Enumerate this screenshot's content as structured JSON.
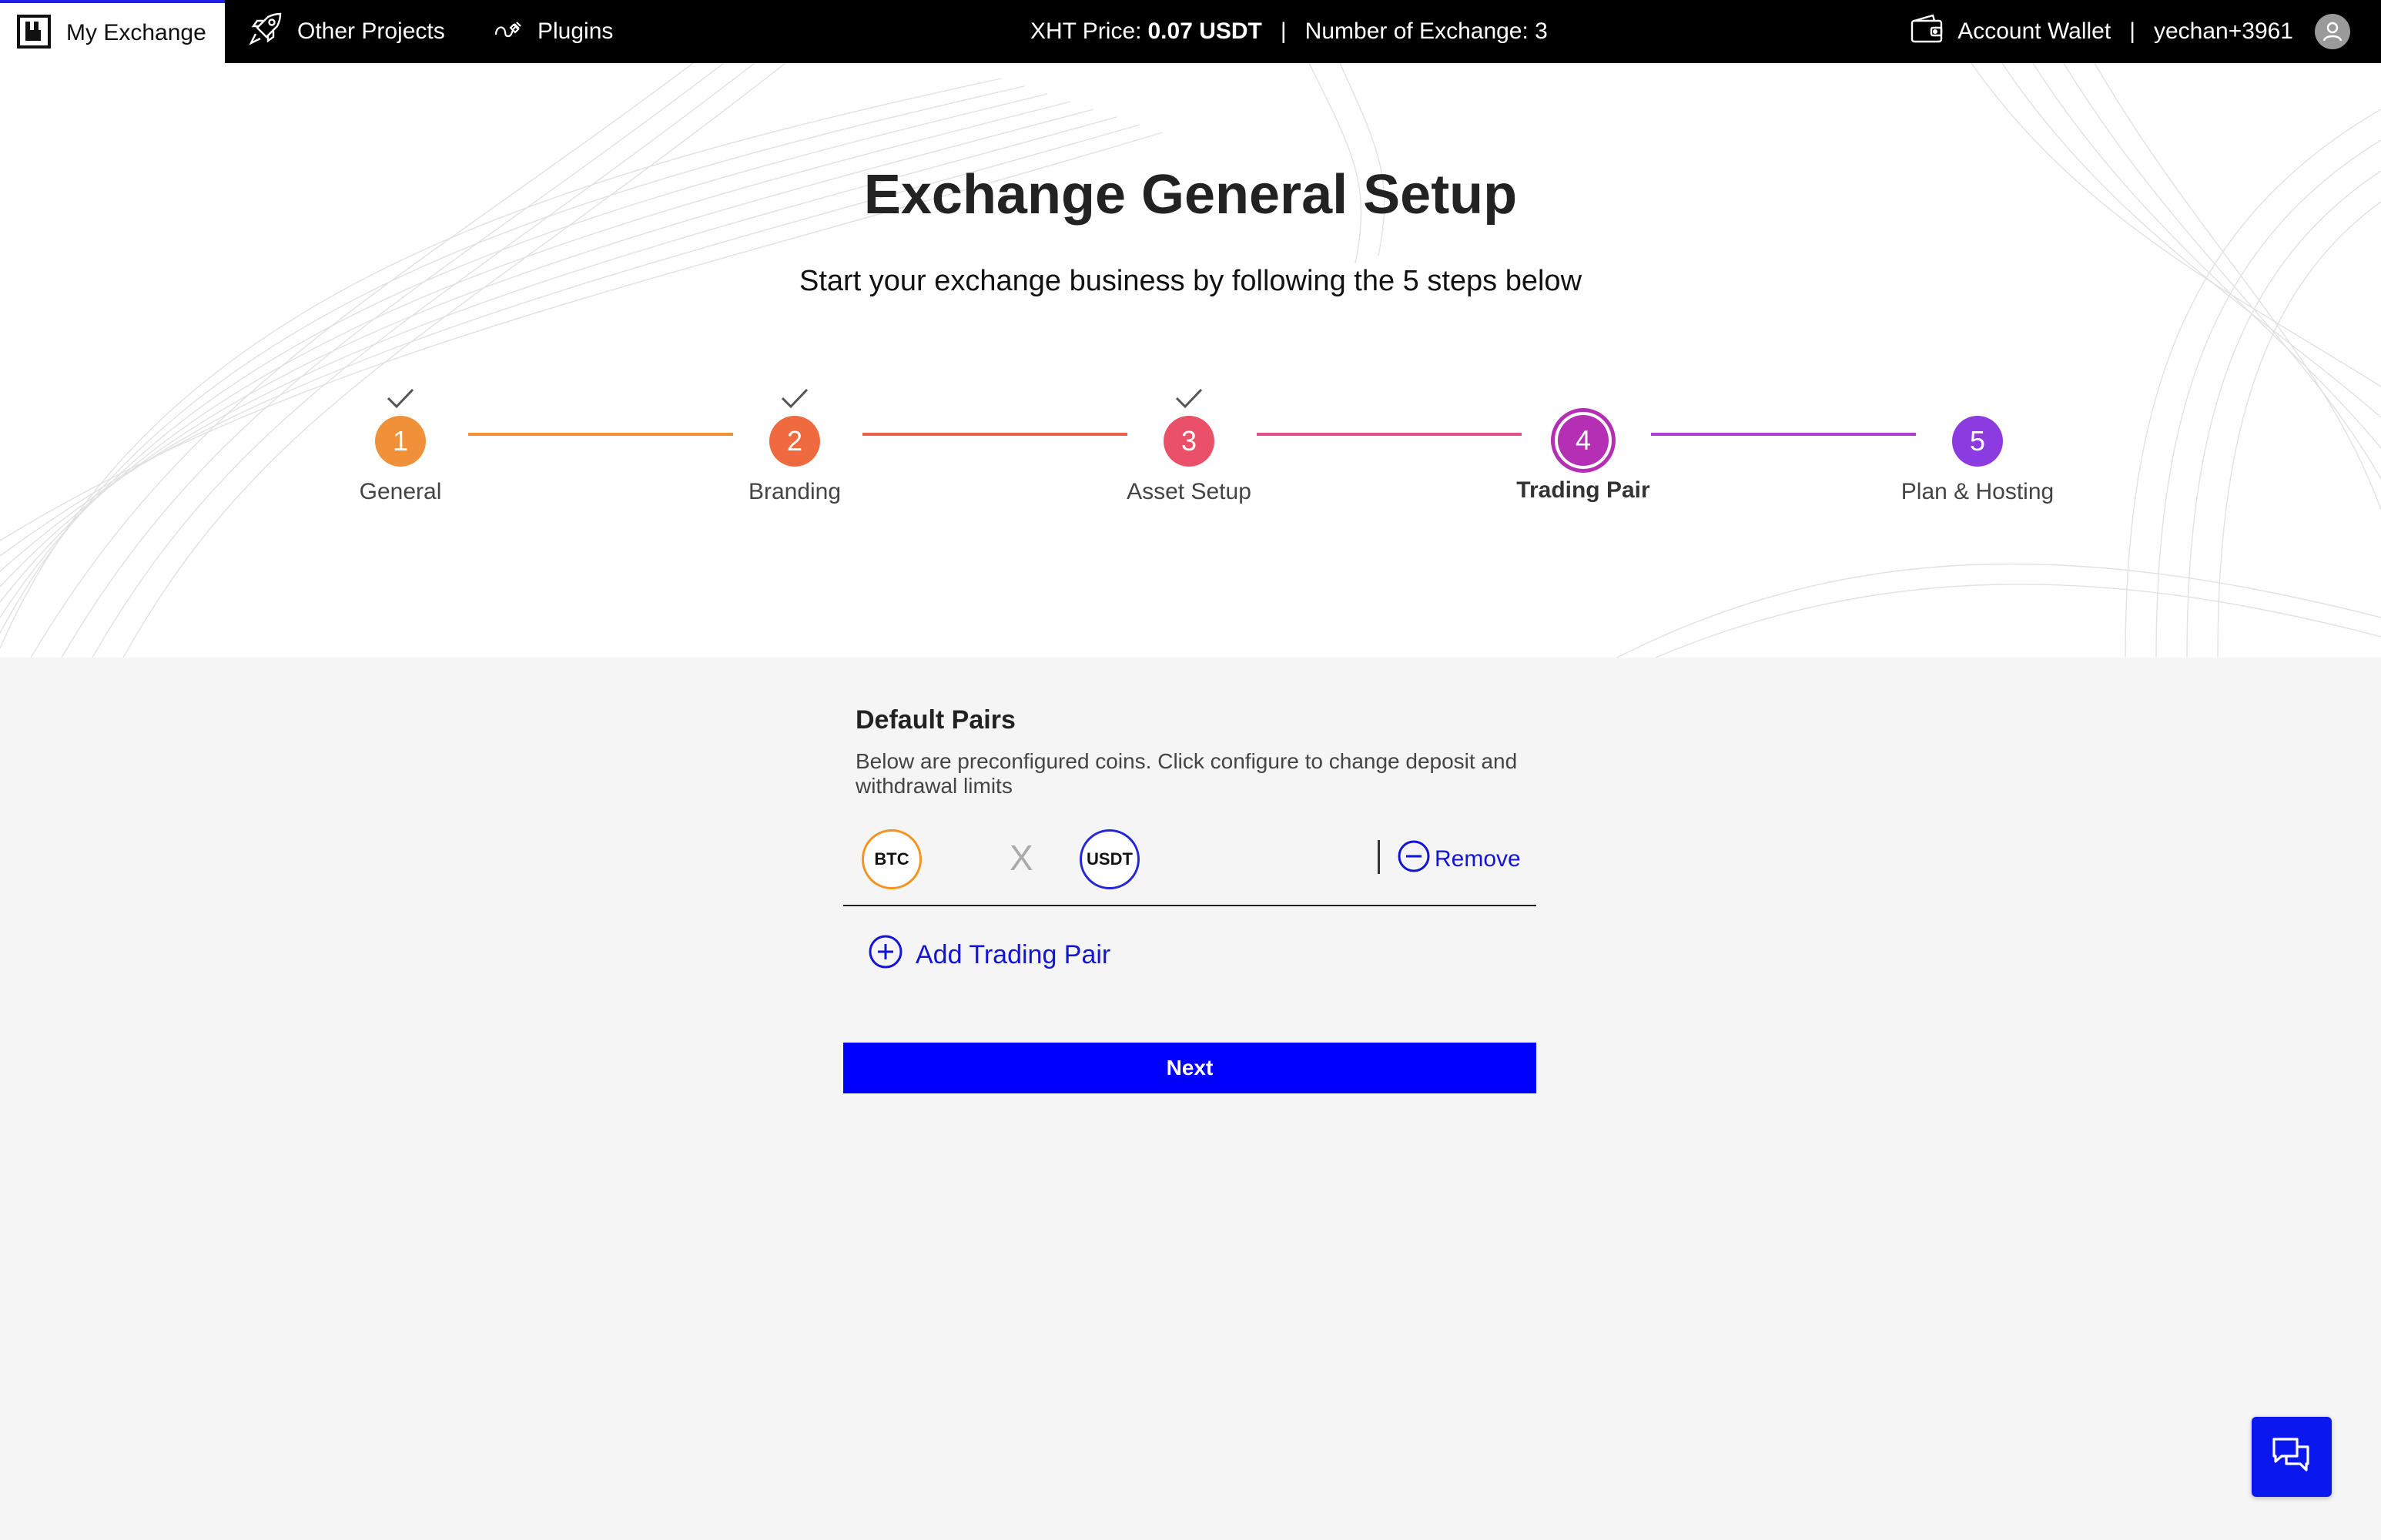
{
  "topbar": {
    "my_exchange": "My Exchange",
    "other_projects": "Other Projects",
    "plugins": "Plugins",
    "price_label": "XHT Price:",
    "price_value": "0.07 USDT",
    "separator": "|",
    "exchange_count": "Number of Exchange: 3",
    "account_wallet": "Account Wallet",
    "username": "yechan+3961"
  },
  "hero": {
    "title": "Exchange General Setup",
    "subtitle": "Start your exchange business by following the 5 steps below"
  },
  "steps": [
    {
      "number": "1",
      "label": "General",
      "status": "completed",
      "color": "#f0913a"
    },
    {
      "number": "2",
      "label": "Branding",
      "status": "completed",
      "color": "#ef6a3f"
    },
    {
      "number": "3",
      "label": "Asset Setup",
      "status": "completed",
      "color": "#ea5068"
    },
    {
      "number": "4",
      "label": "Trading Pair",
      "status": "active",
      "color": "#b42fb4"
    },
    {
      "number": "5",
      "label": "Plan & Hosting",
      "status": "upcoming",
      "color": "#8c3be0"
    }
  ],
  "pairs_section": {
    "title": "Default Pairs",
    "description": "Below are preconfigured coins. Click configure to change deposit and withdrawal limits",
    "pair": {
      "base": "BTC",
      "quote": "USDT",
      "separator": "X"
    },
    "remove_label": "Remove",
    "add_label": "Add Trading Pair"
  },
  "actions": {
    "next_label": "Next"
  },
  "colors": {
    "accent": "#0000ff",
    "link": "#1414d6",
    "btc": "#f39322",
    "usdt": "#2626d9"
  },
  "icons": [
    "logo-icon",
    "rocket-icon",
    "plug-icon",
    "wallet-icon",
    "user-avatar-icon",
    "check-icon",
    "minus-circle-icon",
    "plus-circle-icon",
    "chat-icon"
  ]
}
